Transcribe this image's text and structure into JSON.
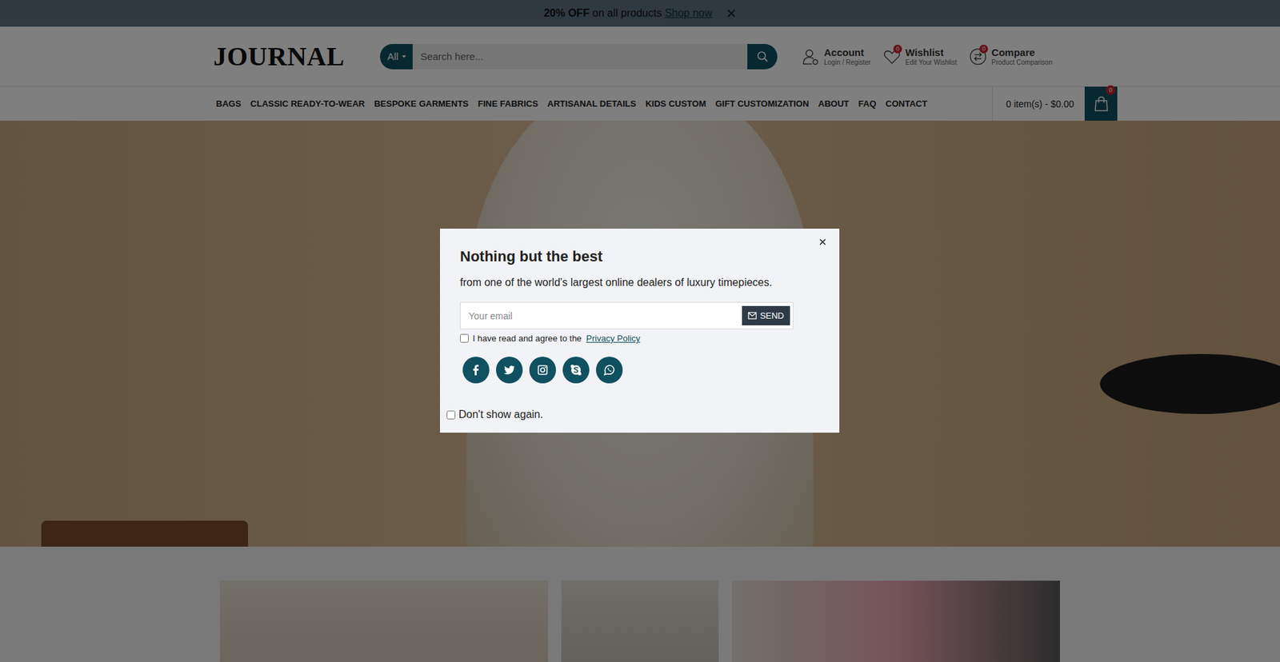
{
  "promo": {
    "bold": "20% OFF",
    "text": "on all products",
    "link": "Shop now"
  },
  "logo": "JOURNAL",
  "search": {
    "category": "All",
    "placeholder": "Search here..."
  },
  "header_links": [
    {
      "kind": "account",
      "title": "Account",
      "subtitle": "Login / Register",
      "badge": ""
    },
    {
      "kind": "wishlist",
      "title": "Wishlist",
      "subtitle": "Edit Your Wishlist",
      "badge": "0"
    },
    {
      "kind": "compare",
      "title": "Compare",
      "subtitle": "Product Comparison",
      "badge": "0"
    }
  ],
  "nav": [
    {
      "label": "BAGS"
    },
    {
      "label": "CLASSIC READY-TO-WEAR"
    },
    {
      "label": "BESPOKE GARMENTS"
    },
    {
      "label": "FINE FABRICS"
    },
    {
      "label": "ARTISANAL DETAILS"
    },
    {
      "label": "KIDS CUSTOM"
    },
    {
      "label": "GIFT CUSTOMIZATION"
    },
    {
      "label": "ABOUT"
    },
    {
      "label": "FAQ"
    },
    {
      "label": "CONTACT"
    }
  ],
  "cart": {
    "summary": "0 item(s) - $0.00",
    "badge": "0"
  },
  "modal": {
    "title": "Nothing but the best",
    "subtitle": "from one of the world's largest online dealers of luxury timepieces.",
    "email_placeholder": "Your email",
    "send": "SEND",
    "consent": {
      "text": "I have read and agree to the",
      "link": "Privacy Policy",
      "checked": false
    },
    "socials": [
      {
        "kind": "facebook"
      },
      {
        "kind": "twitter"
      },
      {
        "kind": "instagram"
      },
      {
        "kind": "skype"
      },
      {
        "kind": "whatsapp"
      }
    ],
    "dont_show": {
      "label": "Don't show again.",
      "checked": false
    }
  }
}
